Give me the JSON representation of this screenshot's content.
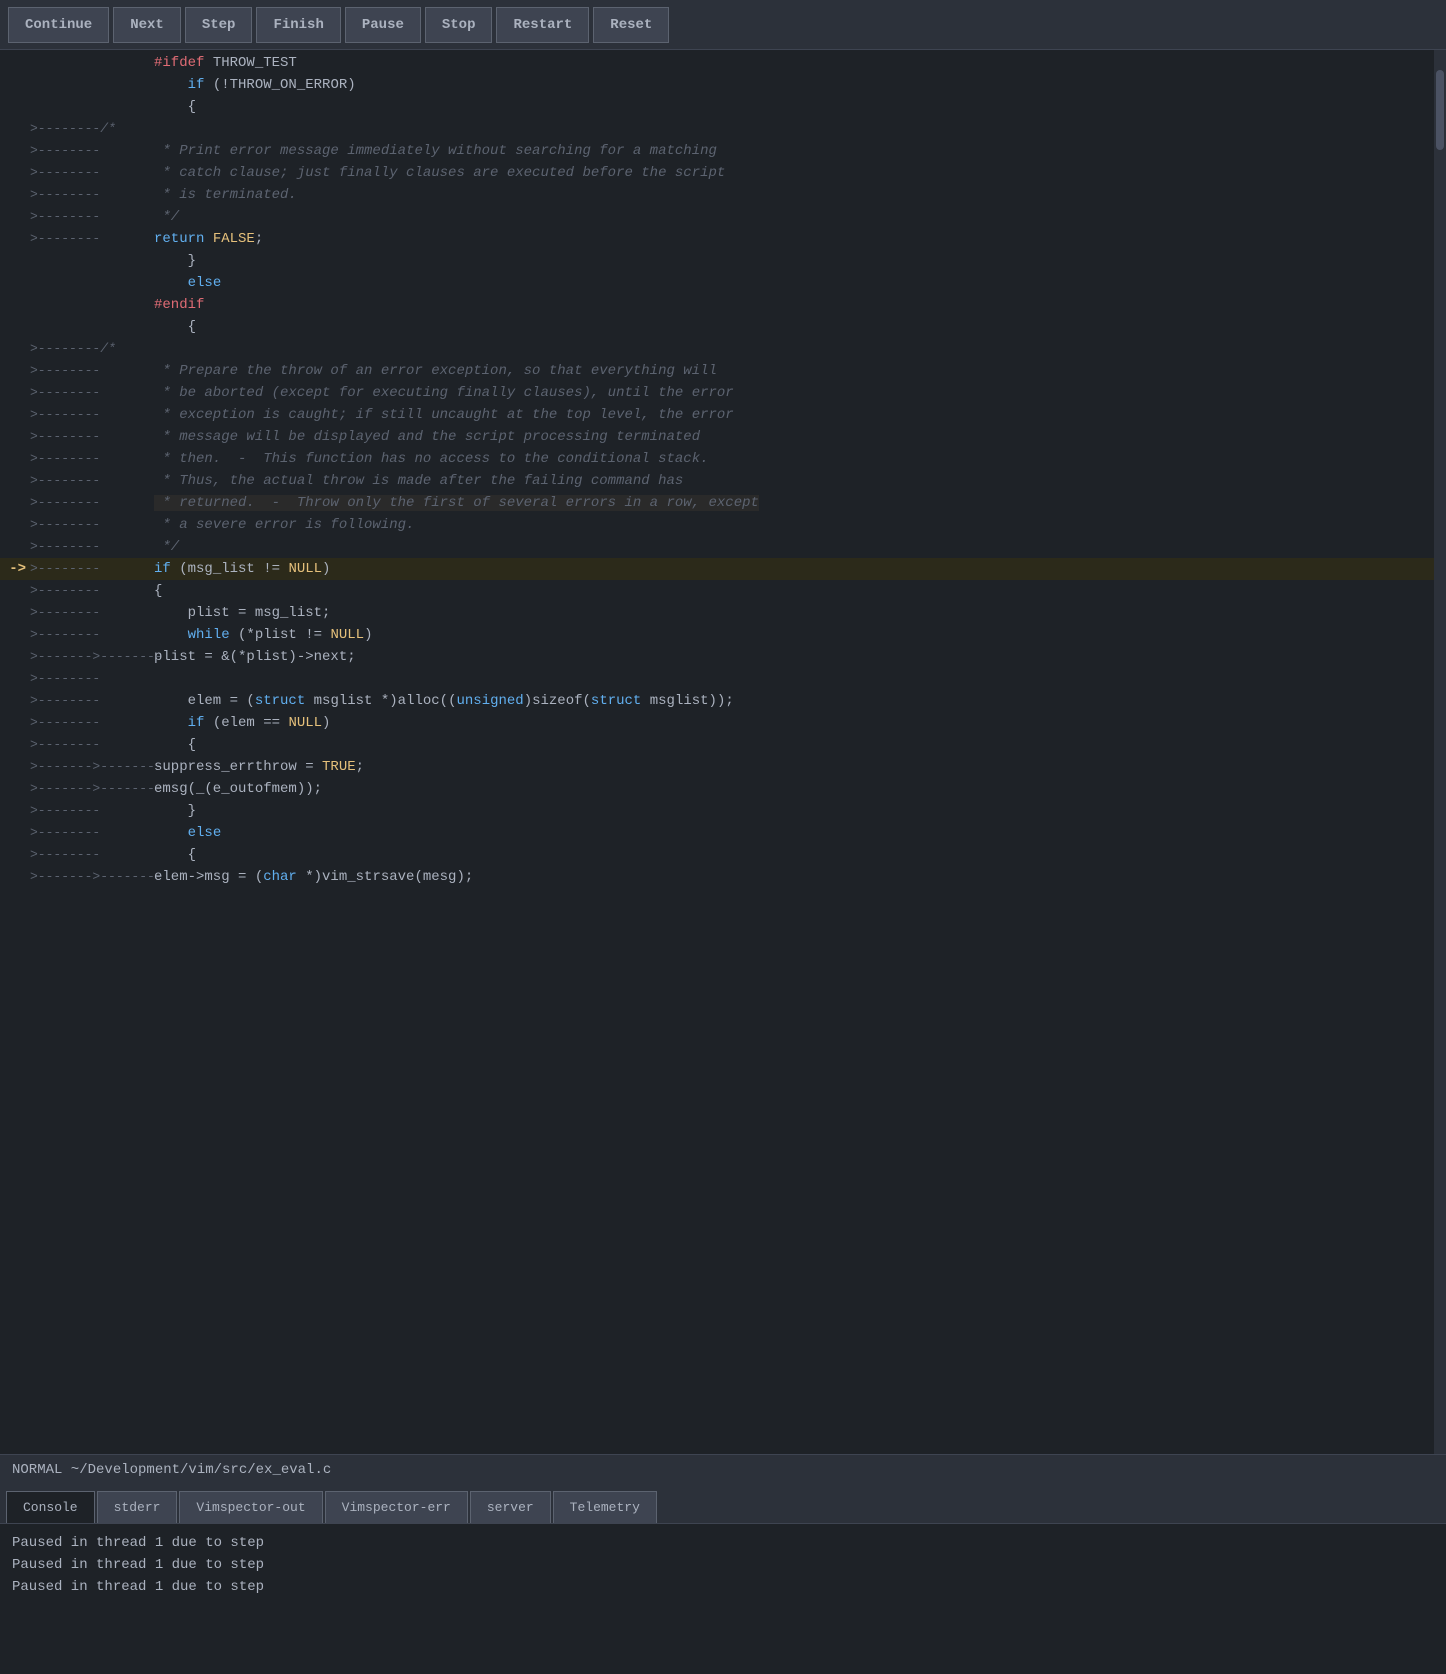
{
  "toolbar": {
    "buttons": [
      {
        "label": "Continue",
        "active": false
      },
      {
        "label": "Next",
        "active": false
      },
      {
        "label": "Step",
        "active": false
      },
      {
        "label": "Finish",
        "active": false
      },
      {
        "label": "Pause",
        "active": false
      },
      {
        "label": "Stop",
        "active": false
      },
      {
        "label": "Restart",
        "active": false
      },
      {
        "label": "Reset",
        "active": false
      }
    ]
  },
  "status_bar": {
    "text": "NORMAL  ~/Development/vim/src/ex_eval.c"
  },
  "bottom_tabs": [
    {
      "label": "Console",
      "active": true
    },
    {
      "label": "stderr",
      "active": false
    },
    {
      "label": "Vimspector-out",
      "active": false
    },
    {
      "label": "Vimspector-err",
      "active": false
    },
    {
      "label": "server",
      "active": false
    },
    {
      "label": "Telemetry",
      "active": false
    }
  ],
  "console_lines": [
    "Paused in thread 1 due to step",
    "Paused in thread 1 due to step",
    "Paused in thread 1 due to step"
  ],
  "code_lines": [
    {
      "gutter": "",
      "arrow": "",
      "content": "#ifdef THROW_TEST",
      "type": "preprocessor"
    },
    {
      "gutter": "",
      "arrow": "",
      "content": "    if (!THROW_ON_ERROR)",
      "type": "normal"
    },
    {
      "gutter": "",
      "arrow": "",
      "content": "    {",
      "type": "normal"
    },
    {
      "gutter": ">--------/*",
      "arrow": "",
      "content": "",
      "type": "comment"
    },
    {
      "gutter": ">--------",
      "arrow": "",
      "content": " * Print error message immediately without searching for a matching",
      "type": "comment"
    },
    {
      "gutter": ">--------",
      "arrow": "",
      "content": " * catch clause; just finally clauses are executed before the script",
      "type": "comment"
    },
    {
      "gutter": ">--------",
      "arrow": "",
      "content": " * is terminated.",
      "type": "comment"
    },
    {
      "gutter": ">--------",
      "arrow": "",
      "content": " */",
      "type": "comment"
    },
    {
      "gutter": ">--------",
      "arrow": "",
      "content": "return FALSE;",
      "type": "normal"
    },
    {
      "gutter": "",
      "arrow": "",
      "content": "    }",
      "type": "normal"
    },
    {
      "gutter": "",
      "arrow": "",
      "content": "    else",
      "type": "kw"
    },
    {
      "gutter": "",
      "arrow": "",
      "content": "#endif",
      "type": "preprocessor"
    },
    {
      "gutter": "",
      "arrow": "",
      "content": "    {",
      "type": "normal"
    },
    {
      "gutter": ">--------/*",
      "arrow": "",
      "content": "",
      "type": "comment"
    },
    {
      "gutter": ">--------",
      "arrow": "",
      "content": " * Prepare the throw of an error exception, so that everything will",
      "type": "comment"
    },
    {
      "gutter": ">--------",
      "arrow": "",
      "content": " * be aborted (except for executing finally clauses), until the error",
      "type": "comment"
    },
    {
      "gutter": ">--------",
      "arrow": "",
      "content": " * exception is caught; if still uncaught at the top level, the error",
      "type": "comment"
    },
    {
      "gutter": ">--------",
      "arrow": "",
      "content": " * message will be displayed and the script processing terminated",
      "type": "comment"
    },
    {
      "gutter": ">--------",
      "arrow": "",
      "content": " * then.  -  This function has no access to the conditional stack.",
      "type": "comment"
    },
    {
      "gutter": ">--------",
      "arrow": "",
      "content": " * Thus, the actual throw is made after the failing command has",
      "type": "comment"
    },
    {
      "gutter": ">--------",
      "arrow": "",
      "content": " * returned.  -  Throw only the first of several errors in a row, except",
      "type": "comment_highlight"
    },
    {
      "gutter": ">--------",
      "arrow": "",
      "content": " * a severe error is following.",
      "type": "comment"
    },
    {
      "gutter": ">--------",
      "arrow": "",
      "content": " */",
      "type": "comment"
    },
    {
      "gutter": ">--------",
      "arrow": "->",
      "content": "if (msg_list != NULL)",
      "type": "current"
    },
    {
      "gutter": ">--------",
      "arrow": "",
      "content": "{",
      "type": "normal"
    },
    {
      "gutter": ">--------",
      "arrow": "",
      "content": "    plist = msg_list;",
      "type": "normal"
    },
    {
      "gutter": ">--------",
      "arrow": "",
      "content": "    while (*plist != NULL)",
      "type": "normal"
    },
    {
      "gutter": ">------->--------",
      "arrow": "",
      "content": "plist = &(*plist)->next;",
      "type": "normal"
    },
    {
      "gutter": ">--------",
      "arrow": "",
      "content": "",
      "type": "normal"
    },
    {
      "gutter": ">--------",
      "arrow": "",
      "content": "    elem = (struct msglist *)alloc((unsigned)sizeof(struct msglist));",
      "type": "normal"
    },
    {
      "gutter": ">--------",
      "arrow": "",
      "content": "    if (elem == NULL)",
      "type": "normal"
    },
    {
      "gutter": ">--------",
      "arrow": "",
      "content": "    {",
      "type": "normal"
    },
    {
      "gutter": ">------->--------",
      "arrow": "",
      "content": "suppress_errthrow = TRUE;",
      "type": "normal"
    },
    {
      "gutter": ">------->--------",
      "arrow": "",
      "content": "emsg(_(e_outofmem));",
      "type": "normal"
    },
    {
      "gutter": ">--------",
      "arrow": "",
      "content": "    }",
      "type": "normal"
    },
    {
      "gutter": ">--------",
      "arrow": "",
      "content": "    else",
      "type": "kw"
    },
    {
      "gutter": ">--------",
      "arrow": "",
      "content": "    {",
      "type": "normal"
    },
    {
      "gutter": ">------->--------",
      "arrow": "",
      "content": "elem->msg = (char *)vim_strsave(mesg);",
      "type": "normal"
    }
  ]
}
